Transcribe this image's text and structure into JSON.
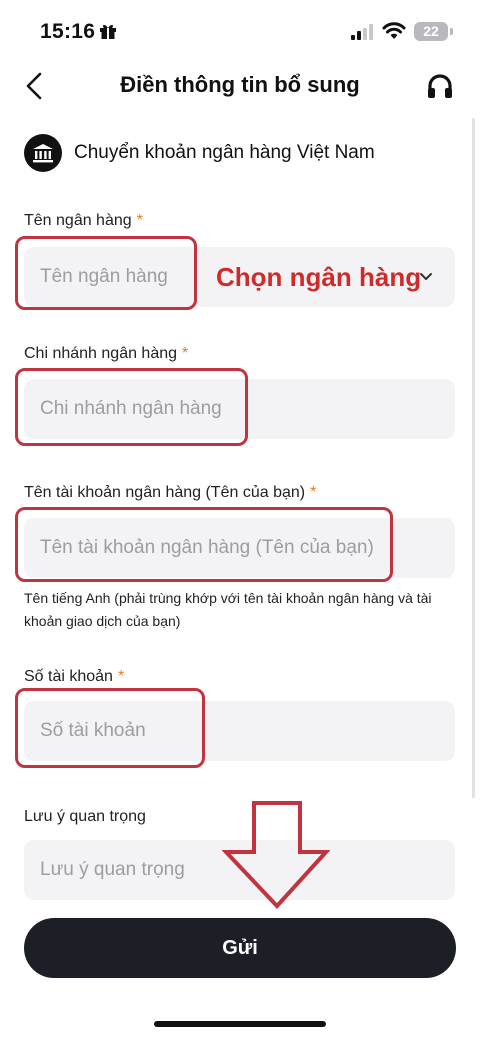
{
  "status_bar": {
    "time": "15:16",
    "battery": "22"
  },
  "header": {
    "title": "Điền thông tin bổ sung"
  },
  "payment_method": {
    "label": "Chuyển khoản ngân hàng Việt Nam"
  },
  "form": {
    "bank_name": {
      "label": "Tên ngân hàng",
      "required": "*",
      "placeholder": "Tên ngân hàng"
    },
    "branch": {
      "label": "Chi nhánh ngân hàng",
      "required": "*",
      "placeholder": "Chi nhánh ngân hàng"
    },
    "account_name": {
      "label": "Tên tài khoản ngân hàng (Tên của bạn)",
      "required": "*",
      "placeholder": "Tên tài khoản ngân hàng (Tên của bạn)",
      "hint": "Tên tiếng Anh (phải trùng khớp với tên tài khoản ngân hàng và tài khoản giao dịch của bạn)"
    },
    "account_number": {
      "label": "Số tài khoản",
      "required": "*",
      "placeholder": "Số tài khoản"
    },
    "note": {
      "label": "Lưu ý quan trọng",
      "placeholder": "Lưu ý quan trọng"
    }
  },
  "annotations": {
    "choose_bank": "Chọn ngân hàng"
  },
  "submit": {
    "label": "Gửi"
  },
  "colors": {
    "annotation_red": "#c0333f",
    "required_orange": "#e8762c",
    "button_dark": "#1d1f27"
  }
}
